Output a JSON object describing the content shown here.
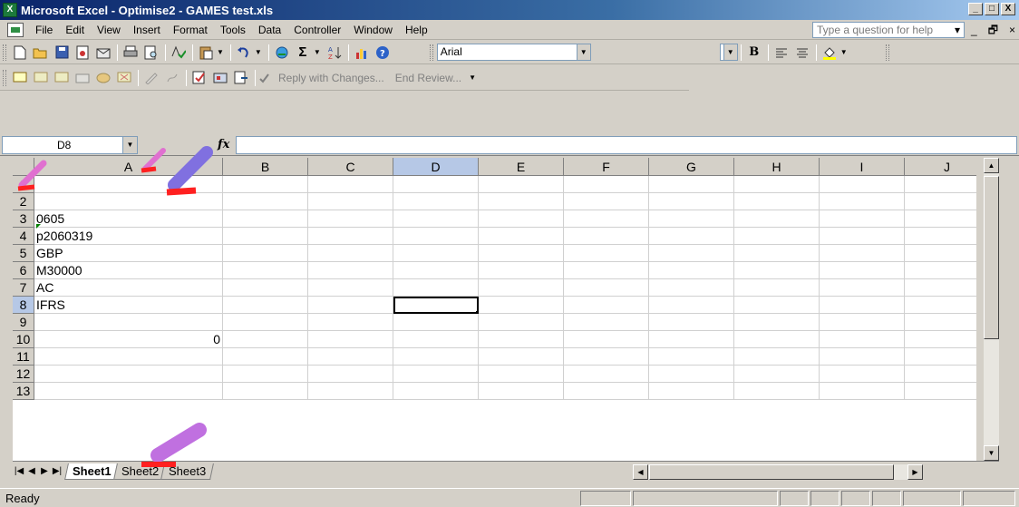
{
  "window": {
    "title": "Microsoft Excel - Optimise2 - GAMES test.xls",
    "app_icon": "X",
    "btn_min": "_",
    "btn_max": "□",
    "btn_close": "X"
  },
  "menubar": {
    "items": [
      "File",
      "Edit",
      "View",
      "Insert",
      "Format",
      "Tools",
      "Data",
      "Controller",
      "Window",
      "Help"
    ],
    "help_placeholder": "Type a question for help",
    "tail": [
      "▾",
      "_",
      "🗗",
      "×"
    ]
  },
  "toolbar": {
    "font_name": "Arial",
    "bold": "B"
  },
  "review_toolbar": {
    "reply_label": "Reply with Changes...",
    "end_label": "End Review..."
  },
  "formula_bar": {
    "name_box": "D8",
    "fx": "fx"
  },
  "grid": {
    "columns": [
      "A",
      "B",
      "C",
      "D",
      "E",
      "F",
      "G",
      "H",
      "I",
      "J"
    ],
    "rows": [
      "1",
      "2",
      "3",
      "4",
      "5",
      "6",
      "7",
      "8",
      "9",
      "10",
      "11",
      "12",
      "13"
    ],
    "selected_column": "D",
    "selected_row": "8",
    "cells": [
      {
        "ref": "A3",
        "value": "0605"
      },
      {
        "ref": "A4",
        "value": "p2060319"
      },
      {
        "ref": "A5",
        "value": "GBP"
      },
      {
        "ref": "A6",
        "value": "M30000"
      },
      {
        "ref": "A7",
        "value": "AC"
      },
      {
        "ref": "A8",
        "value": "IFRS"
      },
      {
        "ref": "A10",
        "value": "0",
        "numeric": true
      }
    ]
  },
  "sheets": {
    "tabs": [
      "Sheet1",
      "Sheet2",
      "Sheet3"
    ],
    "active": "Sheet1"
  },
  "status": {
    "text": "Ready"
  },
  "colors": {
    "title_start": "#0a246a",
    "title_end": "#a6caf0",
    "chrome": "#d4d0c8",
    "selection_header": "#b6c8e6"
  }
}
